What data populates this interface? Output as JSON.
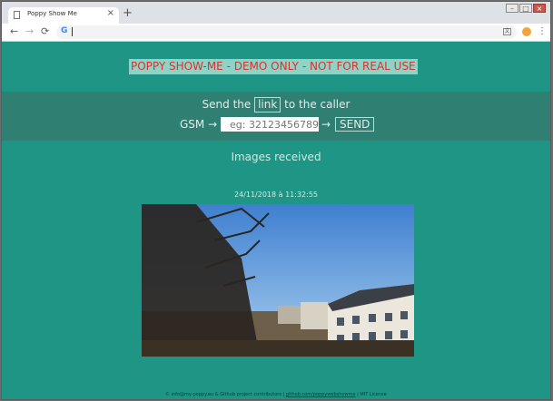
{
  "browser": {
    "tab_title": "Poppy Show Me",
    "new_tab": "+",
    "tab_close": "×",
    "url": "",
    "window_controls": [
      "–",
      "□",
      "×"
    ],
    "nav": {
      "back": "←",
      "forward": "→",
      "reload": "⟳"
    },
    "menu": "⋮",
    "google_icon": "G"
  },
  "page": {
    "banner": "POPPY SHOW-ME - DEMO ONLY - NOT FOR REAL USE",
    "send": {
      "prefix": "Send the",
      "link_label": "link",
      "suffix": "to the caller",
      "gsm_label": "GSM →",
      "gsm_placeholder": "eg: 32123456789",
      "arrow": "→",
      "send_button": "SEND"
    },
    "images_heading": "Images received",
    "image_timestamp": "24/11/2018 à 11:32:55",
    "footer": {
      "text": "© info@my-poppy.eu & Github project contributors |",
      "link": "github.com/poppywebshowme",
      "license": "| MIT License"
    }
  },
  "colors": {
    "page_bg": "#1f9585",
    "panel_bg": "#2f7f73",
    "banner_bg": "#8fd3c6",
    "banner_text": "#d7332e"
  }
}
